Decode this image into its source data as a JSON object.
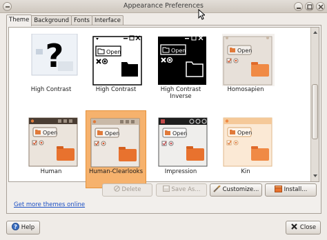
{
  "window": {
    "title": "Appearance Preferences"
  },
  "tabs": [
    {
      "label": "Theme",
      "active": true
    },
    {
      "label": "Background",
      "active": false
    },
    {
      "label": "Fonts",
      "active": false
    },
    {
      "label": "Interface",
      "active": false
    }
  ],
  "themes": [
    {
      "name": "High Contrast",
      "selected": false
    },
    {
      "name": "High Contrast",
      "selected": false
    },
    {
      "name": "High Contrast Inverse",
      "line1": "High Contrast",
      "line2": "Inverse",
      "selected": false
    },
    {
      "name": "Homosapien",
      "selected": false
    },
    {
      "name": "Human",
      "selected": false
    },
    {
      "name": "Human-Clearlooks",
      "selected": true
    },
    {
      "name": "Impression",
      "selected": false
    },
    {
      "name": "Kin",
      "selected": false
    }
  ],
  "preview": {
    "open_label": "Open",
    "missing_glyph": "?"
  },
  "actions": {
    "delete": "Delete",
    "save_as": "Save As...",
    "customize": "Customize...",
    "install": "Install..."
  },
  "link": "Get more themes online",
  "footer": {
    "help": "Help",
    "close": "Close"
  },
  "colors": {
    "selection": "#f6b26d",
    "link": "#1a4ec4",
    "window_bg": "#efebe7"
  }
}
